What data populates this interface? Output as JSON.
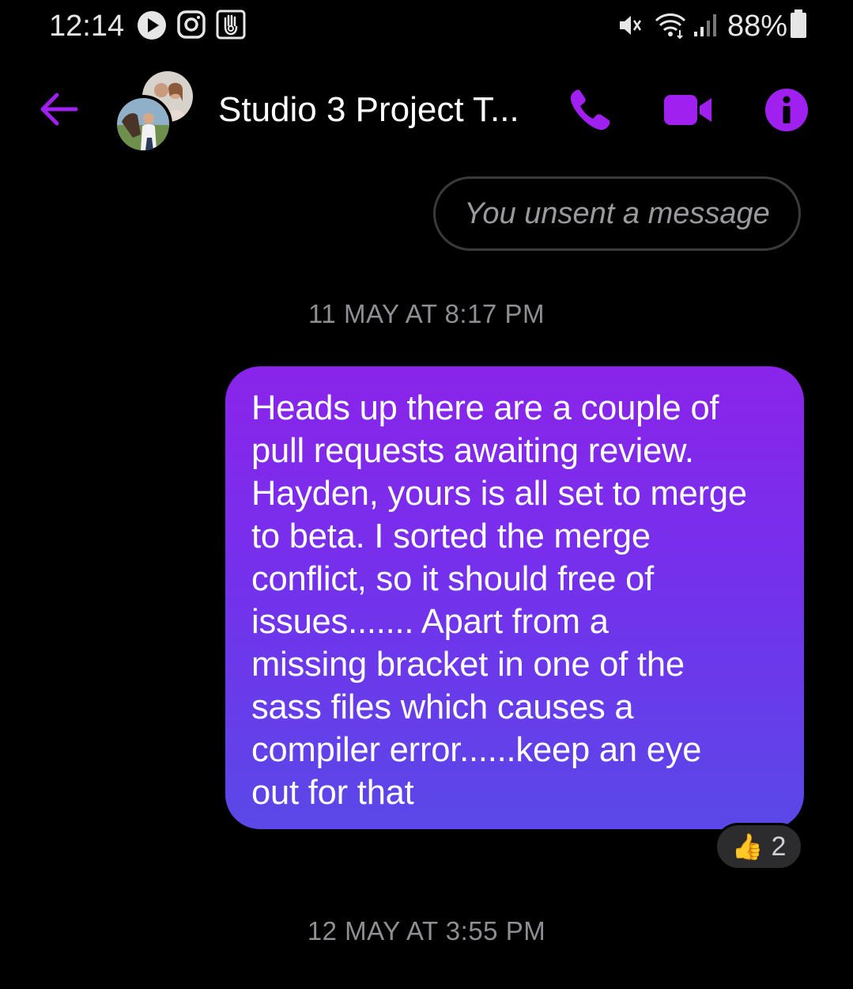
{
  "status_bar": {
    "time": "12:14",
    "battery": "88%",
    "icons": [
      "play-icon",
      "instagram-icon",
      "hand-app-icon",
      "mute-icon",
      "wifi-icon",
      "signal-icon",
      "battery-icon"
    ]
  },
  "header": {
    "title": "Studio 3 Project T...",
    "back_icon": "back-arrow-icon",
    "call_icon": "phone-icon",
    "video_icon": "video-camera-icon",
    "info_icon": "info-icon",
    "accent_color": "#a020f0"
  },
  "messages": {
    "unsent": "You unsent a message",
    "timestamp_1": "11 MAY AT 8:17 PM",
    "bubble_text": "Heads up there are a couple of\npull requests awaiting review.\nHayden, yours is all set to merge\nto beta. I sorted the merge\nconflict, so it should free of\nissues....... Apart from a\nmissing bracket in one of the\nsass files which causes a\ncompiler error......keep an eye\nout for that",
    "reaction_emoji": "👍",
    "reaction_count": "2",
    "timestamp_2": "12 MAY AT 3:55 PM"
  }
}
